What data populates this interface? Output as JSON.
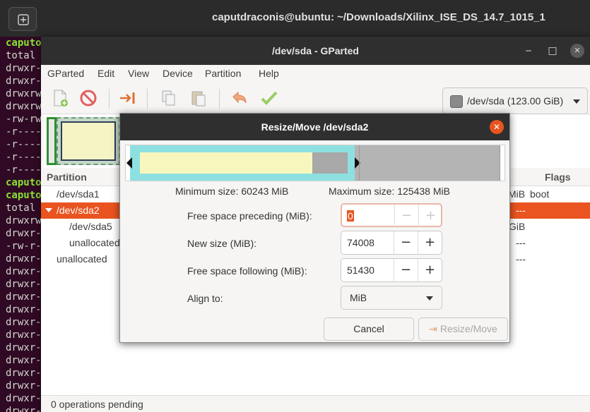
{
  "terminal": {
    "title": "caputdraconis@ubuntu: ~/Downloads/Xilinx_ISE_DS_14.7_1015_1",
    "lines": [
      "caputo",
      "total",
      "drwxr-",
      "drwxr-",
      "drwxrw",
      "drwxrw",
      "-rw-rw",
      "-r----",
      "-r----",
      "-r----",
      "-r----",
      "caputo",
      "caputo",
      "total",
      "drwxrw",
      "drwxr-",
      "-rw-r-",
      "drwxr-",
      "drwxr-",
      "drwxr-",
      "drwxr-",
      "drwxr-",
      "drwxr-",
      "drwxr-",
      "drwxr-",
      "drwxr-",
      "drwxr-",
      "drwxr-",
      "drwxr-",
      "drwxr-"
    ]
  },
  "window": {
    "title": "/dev/sda - GParted",
    "minimize": "‒",
    "maximize": "□",
    "close": "✕"
  },
  "menu": [
    "GParted",
    "Edit",
    "View",
    "Device",
    "Partition",
    "Help"
  ],
  "toolbar": {
    "device": "/dev/sda (123.00 GiB)"
  },
  "table": {
    "headers": {
      "partition": "Partition",
      "flags": "Flags"
    },
    "rows": [
      {
        "partition": "/dev/sda1",
        "size_tail": "MiB",
        "flags": "boot"
      },
      {
        "partition": "/dev/sda2",
        "size_tail": "",
        "flags": "---"
      },
      {
        "partition": "/dev/sda5",
        "size_tail": "GiB",
        "flags": ""
      },
      {
        "partition": "unallocated",
        "size_tail": "",
        "flags": "---"
      },
      {
        "partition": "unallocated",
        "size_tail": "",
        "flags": "---"
      }
    ]
  },
  "status": "0 operations pending",
  "dialog": {
    "title": "Resize/Move /dev/sda2",
    "close": "✕",
    "min_size": "Minimum size: 60243 MiB",
    "max_size": "Maximum size: 125438 MiB",
    "fields": {
      "preceding": {
        "label": "Free space preceding (MiB):",
        "value": "0"
      },
      "new_size": {
        "label": "New size (MiB):",
        "value": "74008"
      },
      "following": {
        "label": "Free space following (MiB):",
        "value": "51430"
      },
      "align": {
        "label": "Align to:",
        "value": "MiB"
      }
    },
    "buttons": {
      "cancel": "Cancel",
      "resize": "Resize/Move"
    }
  }
}
